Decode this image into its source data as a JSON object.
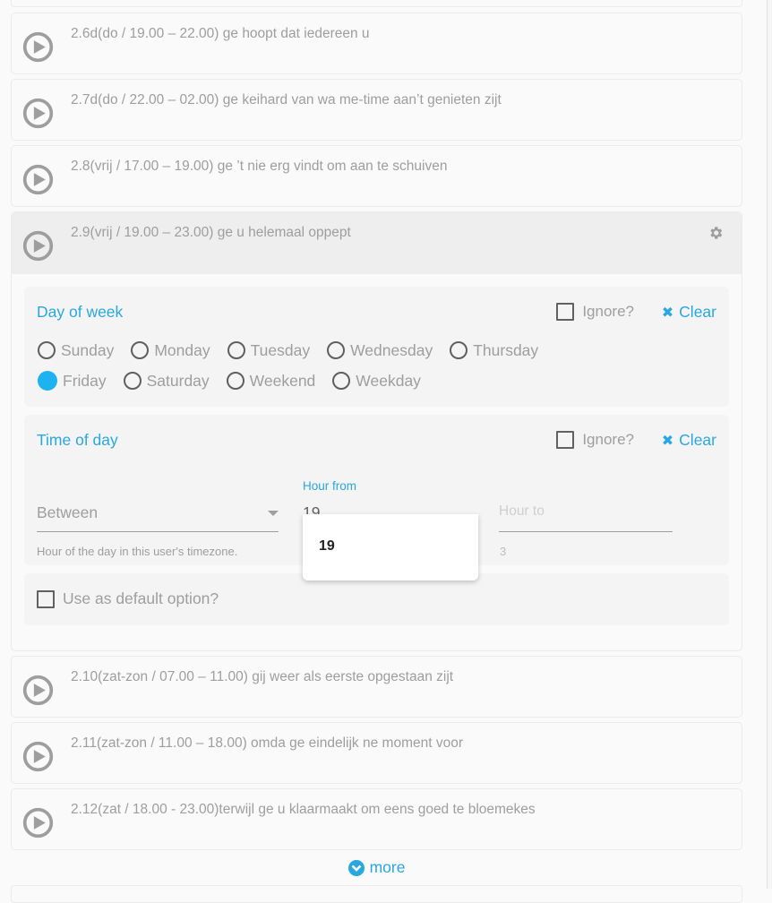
{
  "items_before": [
    {
      "title": "2.6d(do / 19.00 – 22.00) ge hoopt dat iedereen u",
      "icon": "play-circle-icon"
    },
    {
      "title": "2.7d(do / 22.00 – 02.00) ge keihard van wa me-time aan’t genieten zijt",
      "icon": "play-circle-icon"
    },
    {
      "title": "2.8(vrij / 17.00 – 19.00) ge ’t nie erg vindt om aan te schuiven",
      "icon": "play-circle-icon"
    }
  ],
  "expanded_item": {
    "title": "2.9(vrij / 19.00 – 23.00) ge u helemaal oppept",
    "icon": "play-circle-icon",
    "settings_icon": "gear-icon",
    "day_of_week": {
      "title": "Day of week",
      "ignore_label": "Ignore?",
      "ignore_checked": false,
      "clear_label": "Clear",
      "selected": "Friday",
      "options_row1": [
        "Sunday",
        "Monday",
        "Tuesday",
        "Wednesday",
        "Thursday"
      ],
      "options_row2": [
        "Friday",
        "Saturday",
        "Weekend",
        "Weekday"
      ]
    },
    "time_of_day": {
      "title": "Time of day",
      "ignore_label": "Ignore?",
      "ignore_checked": false,
      "clear_label": "Clear",
      "mode_select": {
        "value": "Between"
      },
      "hour_from": {
        "label": "Hour from",
        "value": "19"
      },
      "hour_to": {
        "placeholder": "Hour to",
        "value": ""
      },
      "hint": "Hour of the day in this user's timezone.",
      "hint_tail": "3",
      "autocomplete_options": [
        "19"
      ]
    },
    "default_option": {
      "label": "Use as default option?",
      "checked": false
    }
  },
  "items_after": [
    {
      "title": "2.10(zat-zon / 07.00 – 11.00) gij weer als eerste opgestaan zijt",
      "icon": "play-circle-icon"
    },
    {
      "title": "2.11(zat-zon / 11.00 – 18.00) omda ge eindelijk ne moment voor",
      "icon": "play-circle-icon"
    },
    {
      "title": "2.12(zat / 18.00 - 23.00)terwijl ge u klaarmaakt om eens goed te bloemekes",
      "icon": "play-circle-icon"
    }
  ],
  "more_label": "more",
  "colors": {
    "accent": "#29a8e0",
    "radio_selected": "#1eb3ee",
    "text_muted": "#9e9e9e"
  }
}
